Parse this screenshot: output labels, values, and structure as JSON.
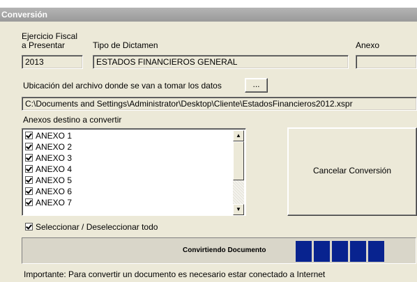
{
  "window": {
    "title": "Conversión"
  },
  "labels": {
    "ejercicio_line1": "Ejercicio Fiscal",
    "ejercicio_line2": "a Presentar",
    "tipo": "Tipo de Dictamen",
    "anexo": "Anexo",
    "ubicacion": "Ubicación del archivo donde se van a tomar los datos",
    "anexos_destino": "Anexos destino a convertir",
    "importante": "Importante: Para convertir un documento es necesario estar conectado a Internet"
  },
  "fields": {
    "ejercicio": "2013",
    "tipo": "ESTADOS FINANCIEROS GENERAL",
    "anexo": "",
    "ruta": "C:\\Documents and Settings\\Administrator\\Desktop\\Cliente\\EstadosFinancieros2012.xspr"
  },
  "buttons": {
    "browse": "...",
    "cancel": "Cancelar Conversión"
  },
  "anexos": [
    {
      "label": "ANEXO 1",
      "checked": true
    },
    {
      "label": "ANEXO 2",
      "checked": true
    },
    {
      "label": "ANEXO 3",
      "checked": true
    },
    {
      "label": "ANEXO 4",
      "checked": true
    },
    {
      "label": "ANEXO 5",
      "checked": true
    },
    {
      "label": "ANEXO 6",
      "checked": true
    },
    {
      "label": "ANEXO 7",
      "checked": true
    }
  ],
  "select_all": {
    "label": "Seleccionar / Deseleccionar todo",
    "checked": true
  },
  "progress": {
    "label": "Convirtiendo Documento",
    "filled_segments": 5,
    "color": "#08238f"
  }
}
